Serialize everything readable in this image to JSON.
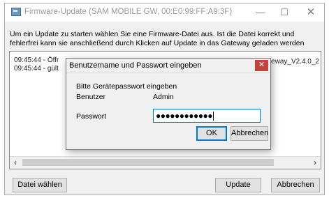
{
  "window": {
    "title": "Firmware-Update (SAM MOBILE GW, 00:E0:99:FF:A9:3F)",
    "controls": {
      "minimize": "—",
      "maximize": "☐",
      "close": "✕"
    }
  },
  "instructions": "Um ein Update zu starten wählen Sie eine Firmware-Datei aus. Ist die Datei korrekt und fehlerfrei kann sie anschließend durch Klicken auf Update in das Gateway geladen werden",
  "log": {
    "lines": [
      "09:45:44 - Öffr",
      "09:45:44 - gült"
    ],
    "file_fragment": "eway_V2.4.0_2"
  },
  "scrollbar": {
    "left": "‹",
    "right": "›"
  },
  "buttons": {
    "choose_file": "Datei wählen",
    "update": "Update",
    "cancel": "Abbrechen"
  },
  "dialog": {
    "title": "Benutzername und Passwort eingeben",
    "close": "✕",
    "prompt": "Bitte Gerätepasswort eingeben",
    "user_label": "Benutzer",
    "user_value": "Admin",
    "password_label": "Passwort",
    "password_masked": "●●●●●●●●●●●●",
    "ok": "OK",
    "cancel": "Abbrechen"
  }
}
